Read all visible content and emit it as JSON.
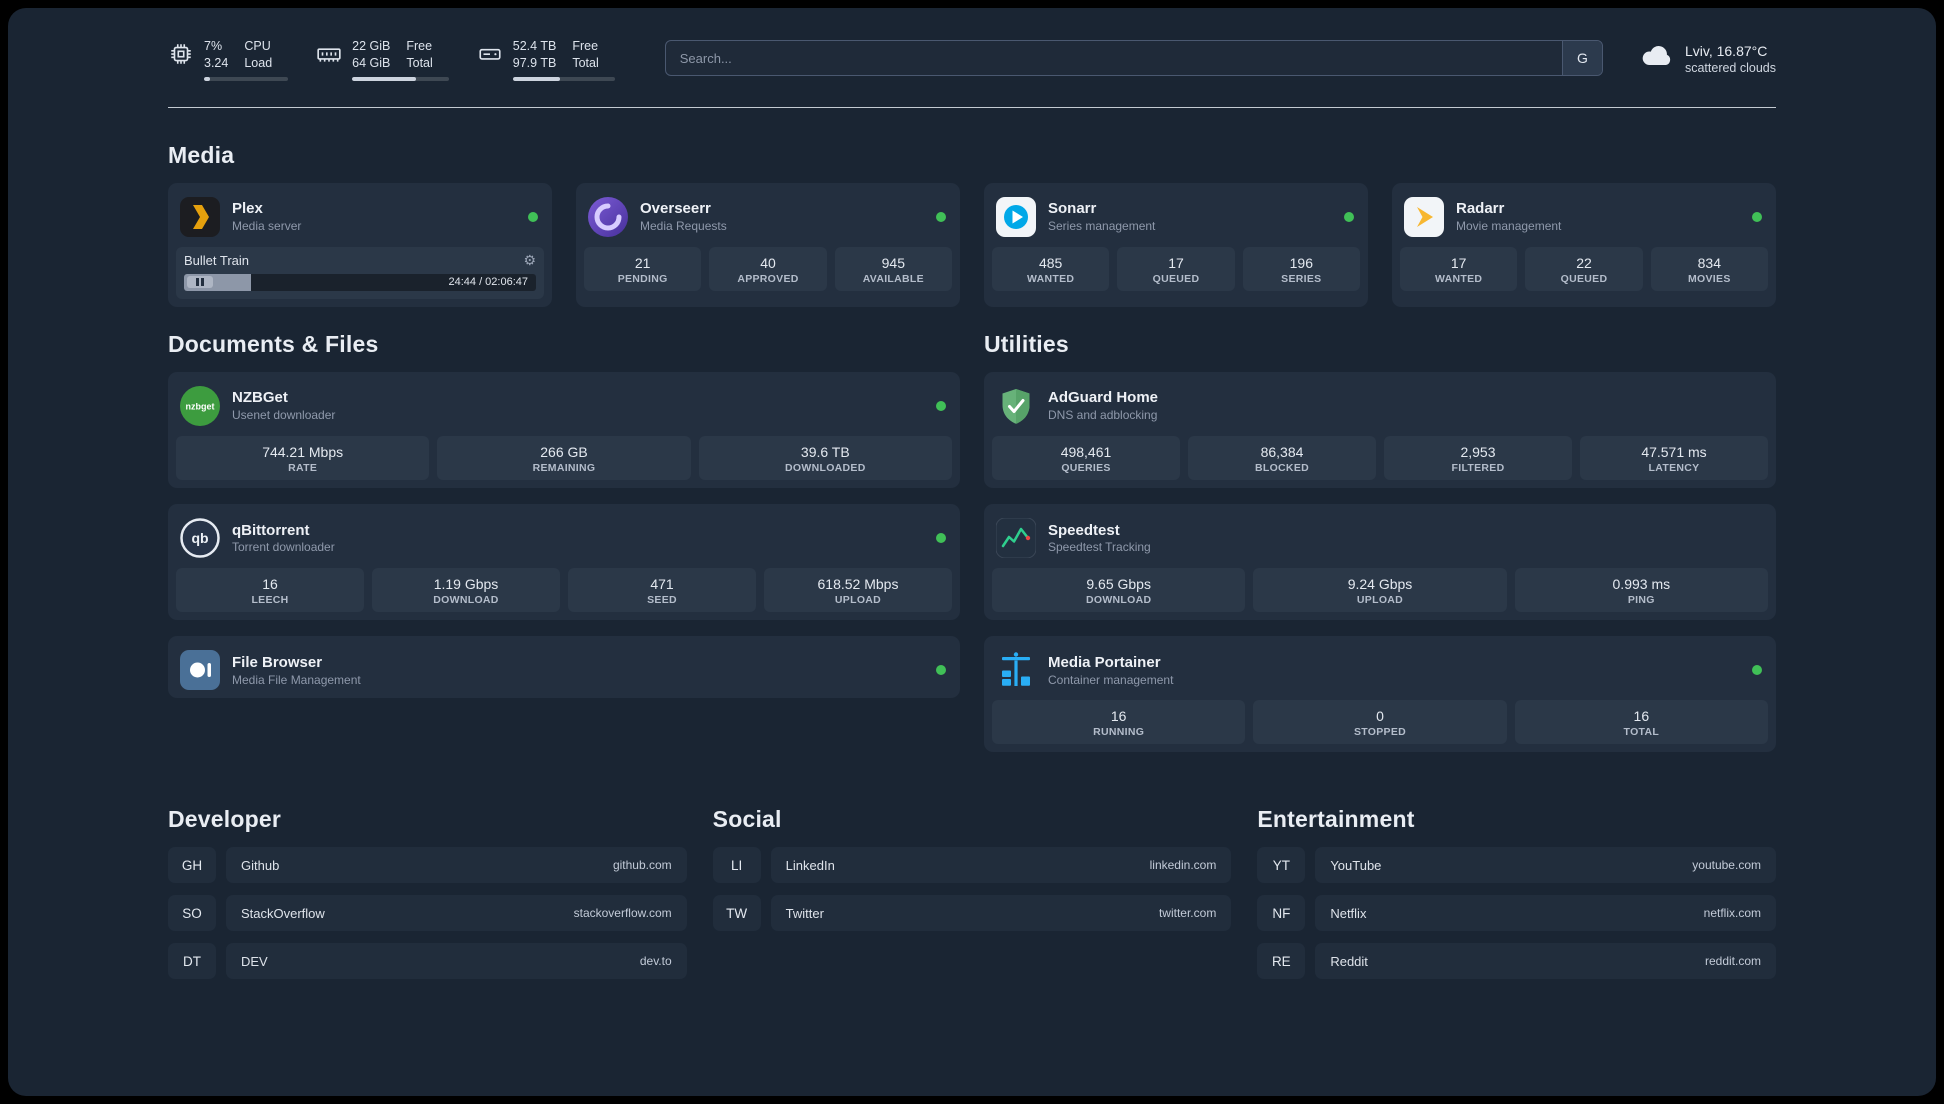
{
  "colors": {
    "status_online": "#40c057"
  },
  "icons": {
    "gear": "⚙",
    "qbittorrent_text": "qb",
    "nzbget_text": "nzbget"
  },
  "topbar": {
    "cpu": {
      "value_top": "7%",
      "value_bottom": "3.24",
      "label_top": "CPU",
      "label_bottom": "Load",
      "bar_percent": 7
    },
    "ram": {
      "value_top": "22 GiB",
      "value_bottom": "64 GiB",
      "label_top": "Free",
      "label_bottom": "Total",
      "bar_percent": 66
    },
    "disk": {
      "value_top": "52.4 TB",
      "value_bottom": "97.9 TB",
      "label_top": "Free",
      "label_bottom": "Total",
      "bar_percent": 46
    },
    "search": {
      "placeholder": "Search...",
      "engine_button": "G"
    },
    "weather": {
      "location": "Lviv, 16.87°C",
      "condition": "scattered clouds"
    }
  },
  "media": {
    "title": "Media",
    "plex": {
      "name": "Plex",
      "subtitle": "Media server",
      "now_playing": "Bullet Train",
      "time": "24:44 / 02:06:47",
      "progress_percent": 19
    },
    "overseerr": {
      "name": "Overseerr",
      "subtitle": "Media Requests",
      "stats": [
        {
          "value": "21",
          "label": "PENDING"
        },
        {
          "value": "40",
          "label": "APPROVED"
        },
        {
          "value": "945",
          "label": "AVAILABLE"
        }
      ]
    },
    "sonarr": {
      "name": "Sonarr",
      "subtitle": "Series management",
      "stats": [
        {
          "value": "485",
          "label": "WANTED"
        },
        {
          "value": "17",
          "label": "QUEUED"
        },
        {
          "value": "196",
          "label": "SERIES"
        }
      ]
    },
    "radarr": {
      "name": "Radarr",
      "subtitle": "Movie management",
      "stats": [
        {
          "value": "17",
          "label": "WANTED"
        },
        {
          "value": "22",
          "label": "QUEUED"
        },
        {
          "value": "834",
          "label": "MOVIES"
        }
      ]
    }
  },
  "documents": {
    "title": "Documents & Files",
    "nzbget": {
      "name": "NZBGet",
      "subtitle": "Usenet downloader",
      "stats": [
        {
          "value": "744.21 Mbps",
          "label": "RATE"
        },
        {
          "value": "266 GB",
          "label": "REMAINING"
        },
        {
          "value": "39.6 TB",
          "label": "DOWNLOADED"
        }
      ]
    },
    "qbittorrent": {
      "name": "qBittorrent",
      "subtitle": "Torrent downloader",
      "stats": [
        {
          "value": "16",
          "label": "LEECH"
        },
        {
          "value": "1.19 Gbps",
          "label": "DOWNLOAD"
        },
        {
          "value": "471",
          "label": "SEED"
        },
        {
          "value": "618.52 Mbps",
          "label": "UPLOAD"
        }
      ]
    },
    "filebrowser": {
      "name": "File Browser",
      "subtitle": "Media File Management"
    }
  },
  "utilities": {
    "title": "Utilities",
    "adguard": {
      "name": "AdGuard Home",
      "subtitle": "DNS and adblocking",
      "stats": [
        {
          "value": "498,461",
          "label": "QUERIES"
        },
        {
          "value": "86,384",
          "label": "BLOCKED"
        },
        {
          "value": "2,953",
          "label": "FILTERED"
        },
        {
          "value": "47.571 ms",
          "label": "LATENCY"
        }
      ]
    },
    "speedtest": {
      "name": "Speedtest",
      "subtitle": "Speedtest Tracking",
      "stats": [
        {
          "value": "9.65 Gbps",
          "label": "DOWNLOAD"
        },
        {
          "value": "9.24 Gbps",
          "label": "UPLOAD"
        },
        {
          "value": "0.993 ms",
          "label": "PING"
        }
      ]
    },
    "portainer": {
      "name": "Media Portainer",
      "subtitle": "Container management",
      "stats": [
        {
          "value": "16",
          "label": "RUNNING"
        },
        {
          "value": "0",
          "label": "STOPPED"
        },
        {
          "value": "16",
          "label": "TOTAL"
        }
      ]
    }
  },
  "bookmarks": {
    "developer": {
      "title": "Developer",
      "items": [
        {
          "abbr": "GH",
          "name": "Github",
          "url": "github.com"
        },
        {
          "abbr": "SO",
          "name": "StackOverflow",
          "url": "stackoverflow.com"
        },
        {
          "abbr": "DT",
          "name": "DEV",
          "url": "dev.to"
        }
      ]
    },
    "social": {
      "title": "Social",
      "items": [
        {
          "abbr": "LI",
          "name": "LinkedIn",
          "url": "linkedin.com"
        },
        {
          "abbr": "TW",
          "name": "Twitter",
          "url": "twitter.com"
        }
      ]
    },
    "entertainment": {
      "title": "Entertainment",
      "items": [
        {
          "abbr": "YT",
          "name": "YouTube",
          "url": "youtube.com"
        },
        {
          "abbr": "NF",
          "name": "Netflix",
          "url": "netflix.com"
        },
        {
          "abbr": "RE",
          "name": "Reddit",
          "url": "reddit.com"
        }
      ]
    }
  }
}
